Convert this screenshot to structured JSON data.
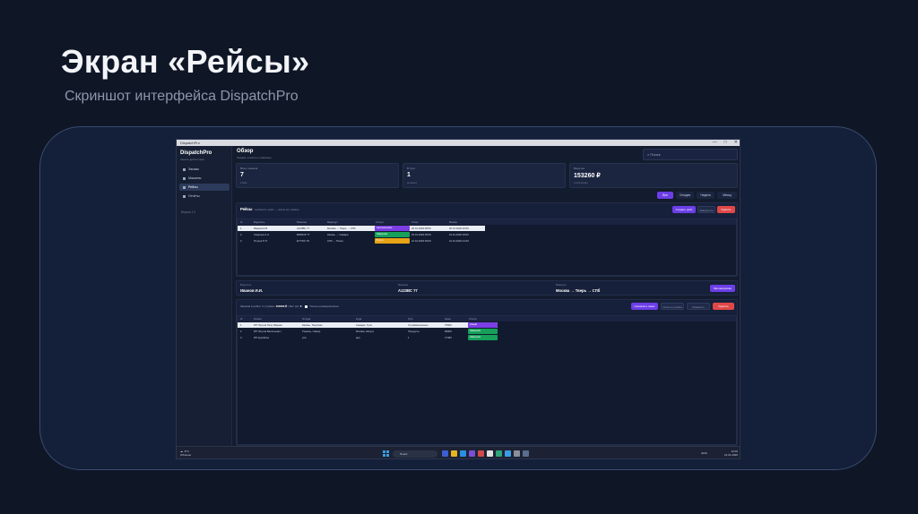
{
  "slide": {
    "title": "Экран «Рейсы»",
    "subtitle": "Скриншот интерфейса DispatchPro"
  },
  "window": {
    "title": "DispatchPro",
    "controls": [
      "—",
      "□",
      "✕"
    ]
  },
  "sidebar": {
    "brand": "DispatchPro",
    "brand_sub": "панель диспетчера",
    "items": [
      {
        "label": "Заказы",
        "icon": "orders-icon"
      },
      {
        "label": "Машины",
        "icon": "truck-icon"
      },
      {
        "label": "Рейсы",
        "icon": "route-icon",
        "active": true
      },
      {
        "label": "Отчёты",
        "icon": "reports-icon"
      }
    ],
    "version": "Версия 1.0"
  },
  "header": {
    "title": "Обзор",
    "subtitle": "Сводка, клиенты и машины.",
    "search_placeholder": "Поиск"
  },
  "stats": [
    {
      "label": "Всего заказов",
      "value": "7",
      "note": "в базе"
    },
    {
      "label": "В пути",
      "value": "1",
      "note": "активных"
    },
    {
      "label": "Выручка",
      "value": "153260 ₽",
      "note": "за всё время"
    }
  ],
  "filters": [
    "Все",
    "Сегодня",
    "Неделя",
    "Месяц"
  ],
  "trips": {
    "title": "Рейсы",
    "hint": "выберите рейс — затем его заказы",
    "buttons": {
      "create": "Создать рейс",
      "complete": "Завершить",
      "delete": "Удалить"
    },
    "columns": [
      "Id",
      "Водитель",
      "Машина",
      "Маршрут",
      "Статус",
      "Старт",
      "Финиш"
    ],
    "rows": [
      {
        "id": "1",
        "driver": "Иванов И.И.",
        "vehicle": "А123ВС 77",
        "route": "Москва → Тверь → СПб",
        "status": "Запланирован",
        "status_color": "#7b3fe4",
        "start": "20.01.2026 08:00",
        "finish": "20.01.2026 20:00",
        "selected": true
      },
      {
        "id": "2",
        "driver": "Смирнов А.А.",
        "vehicle": "В456ОР 77",
        "route": "Казань → Самара",
        "status": "Завершён",
        "status_color": "#16a05a",
        "start": "19.01.2026 06:00",
        "finish": "19.01.2026 18:00"
      },
      {
        "id": "3",
        "driver": "Петров П.П.",
        "vehicle": "Е777КК 78",
        "route": "СПб → Псков",
        "status": "В пути",
        "status_color": "#e6a316",
        "start": "21.01.2026 09:00",
        "finish": "21.01.2026 21:00"
      }
    ]
  },
  "details": {
    "driver_label": "Водитель",
    "driver": "Иванов И.И.",
    "vehicle_label": "Машина",
    "vehicle": "А123ВС 77",
    "route_label": "Маршрут",
    "route": "Москва → Тверь → СПб",
    "status_button": "Запланирован"
  },
  "orders": {
    "summary": "Заказов в рейсе: 3",
    "sum_label": "Сумма:",
    "sum_value": "153260 ₽",
    "weight_label": "Вес (кг):",
    "weight_value": "0",
    "checkbox_label": "Только незавершённые",
    "buttons": {
      "add": "Назначить заказ",
      "remove": "Снять из рейса",
      "edit": "Изменить",
      "delete": "Удалить"
    },
    "columns": [
      "Id",
      "Клиент",
      "Откуда",
      "Куда",
      "Груз",
      "Цена",
      "Статус"
    ],
    "rows": [
      {
        "id": "1",
        "client": "ИП Петров Петр Иванов",
        "from": "Казань, Тверская",
        "to": "Самара, Тула",
        "cargo": "Стройматериалы",
        "price": "75000",
        "status": "Новый",
        "status_color": "#7b3fe4",
        "selected": true
      },
      {
        "id": "2",
        "client": "ИП Петров Васильевич",
        "from": "Тюмень, Самар",
        "to": "Москва, Калуга",
        "cargo": "Продукты",
        "price": "60800",
        "status": "Завершён",
        "status_color": "#16a05a"
      },
      {
        "id": "3",
        "client": "ИП Куряйлен",
        "from": "упа",
        "to": "ара",
        "cargo": "1",
        "price": "17460",
        "status": "Завершён",
        "status_color": "#16a05a"
      }
    ]
  },
  "taskbar": {
    "weather_temp": "-6°C",
    "weather_text": "Облачно",
    "search": "Поиск",
    "time": "12:00",
    "date": "21.01.2026",
    "lang": "ENG"
  }
}
